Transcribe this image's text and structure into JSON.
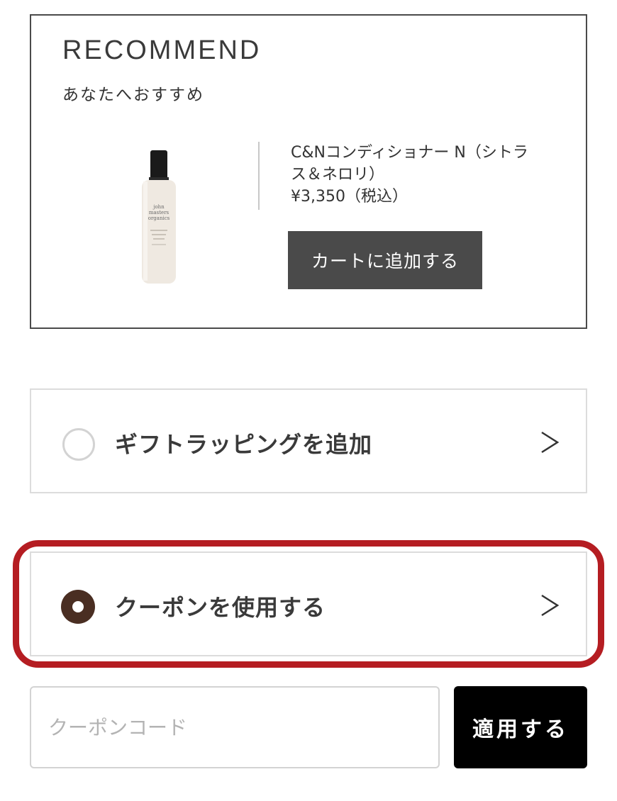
{
  "recommend": {
    "title": "RECOMMEND",
    "subtitle": "あなたへおすすめ",
    "product": {
      "name": "C&Nコンディショナー N（シトラス＆ネロリ）",
      "price": "¥3,350（税込）",
      "image_icon": "conditioner-bottle-image",
      "bottle_text": [
        "john",
        "masters",
        "organics"
      ]
    },
    "add_to_cart_label": "カートに追加する"
  },
  "options": {
    "gift_wrapping": {
      "label": "ギフトラッピングを追加",
      "selected": false
    },
    "coupon": {
      "label": "クーポンを使用する",
      "selected": true
    }
  },
  "coupon_form": {
    "placeholder": "クーポンコード",
    "value": "",
    "apply_label": "適用する"
  },
  "colors": {
    "highlight": "#b51d22",
    "radio_selected": "#4a2e22",
    "cart_button": "#4a4a4a",
    "apply_button": "#000000"
  }
}
